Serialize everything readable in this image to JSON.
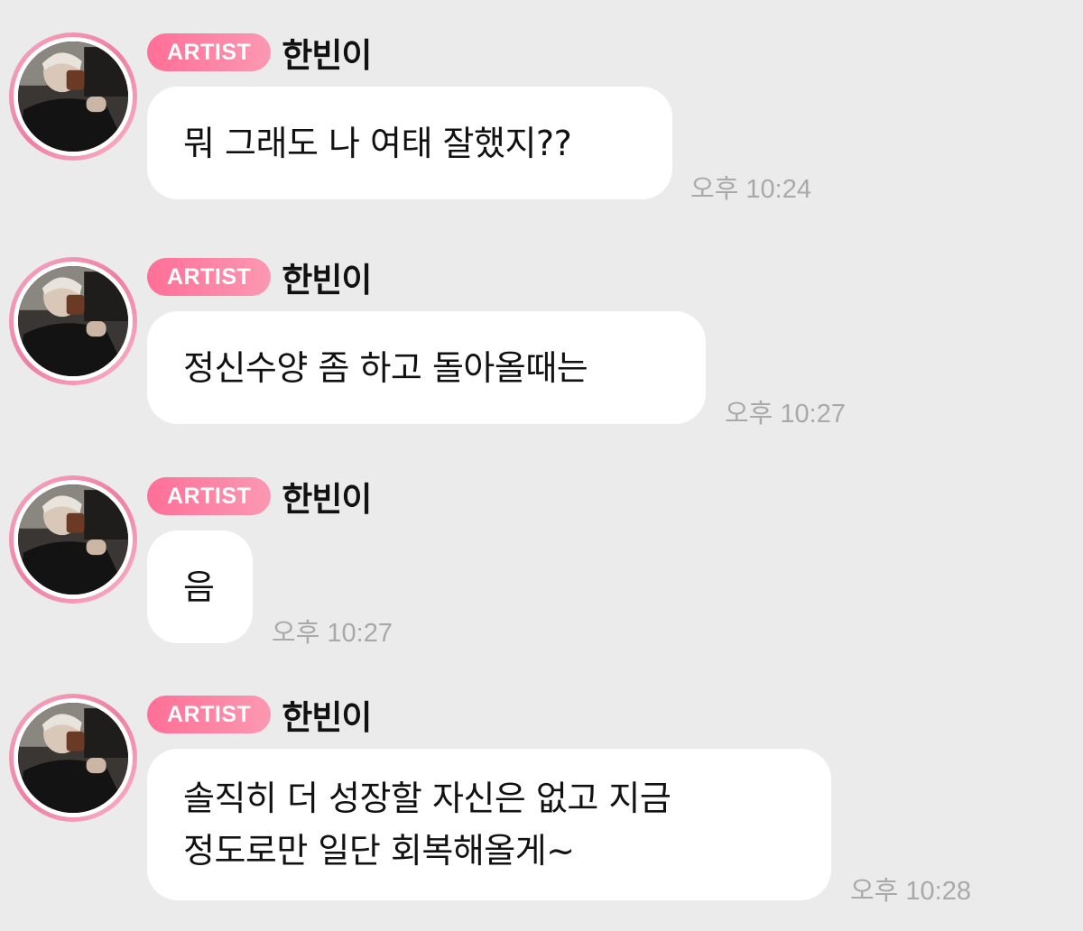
{
  "messages": [
    {
      "badge": "ARTIST",
      "sender": "한빈이",
      "text": "뭐 그래도 나 여태 잘했지??",
      "time": "오후 10:24"
    },
    {
      "badge": "ARTIST",
      "sender": "한빈이",
      "text": "정신수양 좀 하고 돌아올때는",
      "time": "오후 10:27"
    },
    {
      "badge": "ARTIST",
      "sender": "한빈이",
      "text": "음",
      "time": "오후 10:27"
    },
    {
      "badge": "ARTIST",
      "sender": "한빈이",
      "text": "솔직히 더 성장할 자신은 없고 지금\n정도로만 일단 회복해올게~",
      "time": "오후 10:28"
    }
  ],
  "colors": {
    "background": "#ebebeb",
    "badge_gradient_start": "#ff6f97",
    "badge_gradient_end": "#fb98b2",
    "avatar_ring": "#ee7fa3",
    "bubble": "#ffffff",
    "timestamp": "#a9a9a9"
  },
  "icons": {
    "avatar": "artist-profile-photo"
  }
}
